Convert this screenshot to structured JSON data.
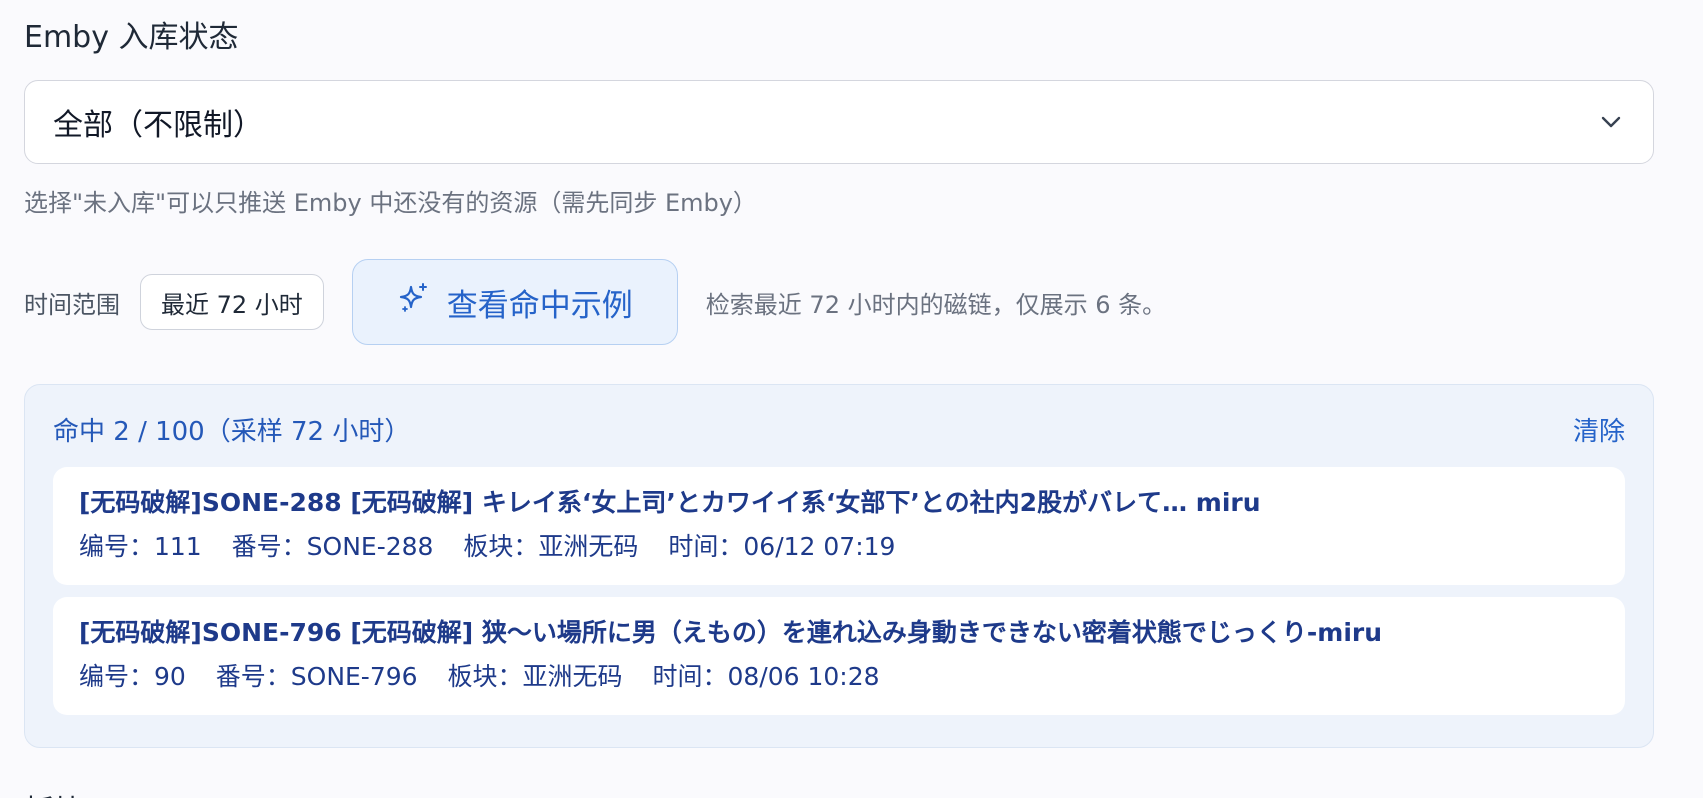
{
  "emby_filter": {
    "label": "Emby 入库状态",
    "selected": "全部（不限制）",
    "hint": "选择\"未入库\"可以只推送 Emby 中还没有的资源（需先同步 Emby）"
  },
  "time_range": {
    "label": "时间范围",
    "value": "最近 72 小时",
    "example_button": "查看命中示例",
    "description": "检索最近 72 小时内的磁链，仅展示 6 条。"
  },
  "results": {
    "summary": "命中 2 / 100（采样 72 小时）",
    "clear_label": "清除",
    "items": [
      {
        "title": "[无码破解]SONE-288 [无码破解] キレイ系‘女上司’とカワイイ系‘女部下’との社内2股がバレて… miru",
        "id": "编号：111",
        "code": "番号：SONE-288",
        "board": "板块：亚洲无码",
        "time": "时间：06/12 07:19"
      },
      {
        "title": "[无码破解]SONE-796 [无码破解] 狭～い場所に男（えもの）を連れ込み身動きできない密着状態でじっくり-miru",
        "id": "编号：90",
        "code": "番号：SONE-796",
        "board": "板块：亚洲无码",
        "time": "时间：08/06 10:28"
      }
    ]
  },
  "next_section_label": "板块",
  "colors": {
    "accent": "#2563c9",
    "panel_bg": "#eef3fb",
    "item_text": "#1e3a8a"
  }
}
